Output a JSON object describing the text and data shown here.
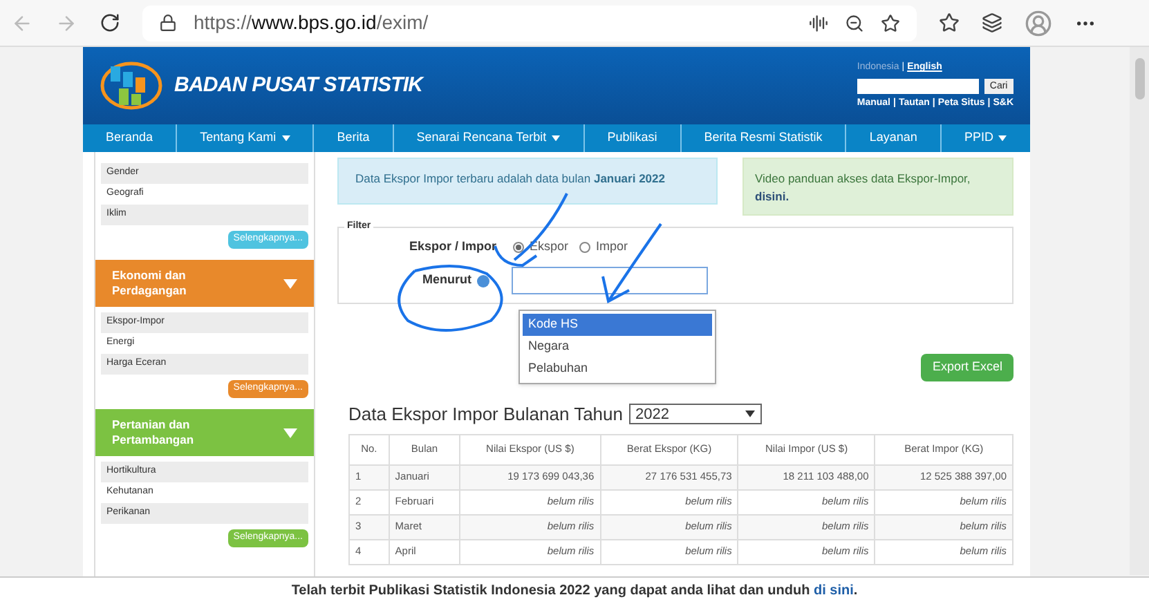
{
  "browser": {
    "url_scheme": "https://",
    "url_host": "www.bps.go.id",
    "url_path": "/exim/"
  },
  "header": {
    "site_title": "BADAN PUSAT STATISTIK",
    "languages": [
      {
        "label": "Indonesia",
        "selected": true
      },
      {
        "label": "English",
        "selected": false
      }
    ],
    "search_button": "Cari",
    "separator": "|",
    "links": [
      "Manual",
      "Tautan",
      "Peta Situs",
      "S&K"
    ]
  },
  "nav": [
    {
      "label": "Beranda",
      "has_menu": false
    },
    {
      "label": "Tentang Kami",
      "has_menu": true
    },
    {
      "label": "Berita",
      "has_menu": false
    },
    {
      "label": "Senarai Rencana Terbit",
      "has_menu": true
    },
    {
      "label": "Publikasi",
      "has_menu": false
    },
    {
      "label": "Berita Resmi Statistik",
      "has_menu": false
    },
    {
      "label": "Layanan",
      "has_menu": false
    },
    {
      "label": "PPID",
      "has_menu": true
    }
  ],
  "sidebar": [
    {
      "items": [
        "Gender",
        "Geografi",
        "Iklim"
      ],
      "more_button": "Selengkapnya...",
      "color": "#4fc3e0"
    },
    {
      "title": "Ekonomi dan Perdagangan",
      "items": [
        "Ekspor-Impor",
        "Energi",
        "Harga Eceran"
      ],
      "more_button": "Selengkapnya...",
      "color": "#e8892b"
    },
    {
      "title": "Pertanian dan Pertambangan",
      "items": [
        "Hortikultura",
        "Kehutanan",
        "Perikanan"
      ],
      "more_button": "Selengkapnya...",
      "color": "#7cc242"
    }
  ],
  "info_notice": "Data Ekspor Impor terbaru adalah data bulan **Januari 2022**",
  "video_notice": {
    "text": "Video panduan akses data Ekspor-Impor,",
    "link": "disini."
  },
  "filter": {
    "legend": "Filter",
    "type_label": "Ekspor / Impor",
    "radios": [
      {
        "label": "Ekspor",
        "selected": true
      },
      {
        "label": "Impor",
        "selected": false
      }
    ],
    "by_label": "Menurut",
    "options": [
      {
        "label": "Kode HS",
        "selected": true
      },
      {
        "label": "Negara",
        "selected": false
      },
      {
        "label": "Pelabuhan",
        "selected": false
      }
    ]
  },
  "export_button": "Export Excel",
  "table_title": "Data Ekspor Impor Bulanan Tahun",
  "year": "2022",
  "table": {
    "columns": [
      "No.",
      "Bulan",
      "Nilai Ekspor (US $)",
      "Berat Ekspor (KG)",
      "Nilai Impor (US $)",
      "Berat Impor (KG)"
    ],
    "rows": [
      [
        "1",
        "Januari",
        "19 173 699 043,36",
        "27 176 531 455,73",
        "18 211 103 488,00",
        "12 525 388 397,00"
      ],
      [
        "2",
        "Februari",
        "belum rilis",
        "belum rilis",
        "belum rilis",
        "belum rilis"
      ],
      [
        "3",
        "Maret",
        "belum rilis",
        "belum rilis",
        "belum rilis",
        "belum rilis"
      ],
      [
        "4",
        "April",
        "belum rilis",
        "belum rilis",
        "belum rilis",
        "belum rilis"
      ]
    ]
  },
  "banner": {
    "text": "Telah terbit Publikasi Statistik Indonesia 2022 yang dapat anda lihat dan unduh",
    "link": "di sini",
    "end": "."
  }
}
